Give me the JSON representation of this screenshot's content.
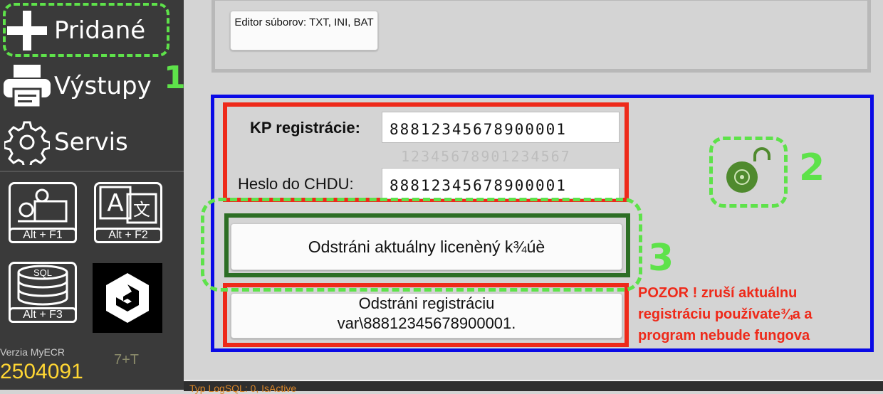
{
  "sidebar": {
    "menu": [
      {
        "label": "Pridané",
        "icon": "plus-icon"
      },
      {
        "label": "Výstupy",
        "icon": "printer-icon"
      },
      {
        "label": "Servis",
        "icon": "gear-icon"
      }
    ],
    "tiles": [
      {
        "caption": "Alt + F1",
        "icon": "settings-computer-icon"
      },
      {
        "caption": "Alt + F2",
        "icon": "translate-icon"
      },
      {
        "caption": "Alt + F3",
        "icon": "sql-database-icon",
        "badge": "SQL"
      },
      {
        "caption": "",
        "icon": "app-logo-icon"
      }
    ],
    "version_label": "Verzia MyECR",
    "version_number": "2504091",
    "build_tag": "7+T"
  },
  "main": {
    "editor_button": "Editor súborov: TXT, INI, BAT",
    "kp_label": "KP registrácie:",
    "kp_value": "88812345678900001",
    "kp_hint": "12345678901234567",
    "heslo_label": "Heslo do CHDU:",
    "heslo_value": "88812345678900001",
    "remove_license_button": "Odstráni aktuálny licenèný k¾úè",
    "remove_registration_button_line1": "Odstráni registráciu",
    "remove_registration_button_line2": "var\\88812345678900001.",
    "warning": "POZOR ! zruší aktuálnu registráciu používate¾a a program nebude fungova",
    "lock_icon": "unlocked-padlock-icon"
  },
  "annotations": [
    "1",
    "2",
    "3"
  ],
  "bottom": {
    "status_text": "Typ LogSQL: 0, IsActive"
  },
  "colors": {
    "annotation_green": "#5ee24a",
    "frame_blue": "#0a0ae6",
    "frame_red": "#ee2a1a",
    "frame_dark_green": "#2d6e25",
    "lock_green": "#4f8a2e",
    "version_yellow": "#ffd633"
  }
}
